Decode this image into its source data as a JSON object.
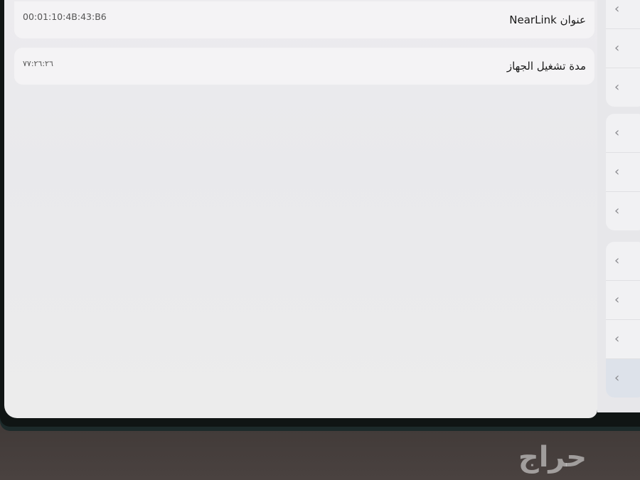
{
  "settings": {
    "rows": [
      {
        "label": "عنوان NearLink",
        "value": "00:01:10:4B:43:B6"
      },
      {
        "label": "مدة تشغيل الجهاز",
        "value": "٧٧:٢٦:٢٦"
      }
    ]
  },
  "sidebar": {
    "chevron": "‹",
    "groups": [
      {
        "items": 3,
        "active_index": -1
      },
      {
        "items": 3,
        "active_index": -1
      },
      {
        "items": 4,
        "active_index": 3
      }
    ]
  },
  "watermark": {
    "text": "حراج"
  },
  "colors": {
    "pane": "#ecebee",
    "card": "#f4f3f5",
    "sidebar": "#e7e7ea",
    "active_item": "#dde2ea"
  }
}
